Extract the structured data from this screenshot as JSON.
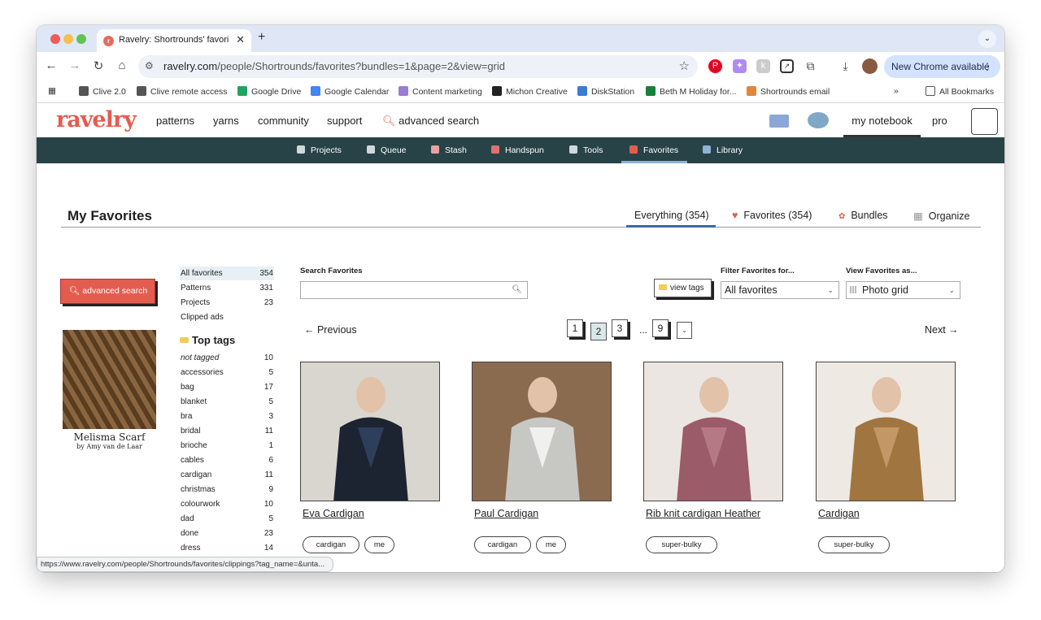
{
  "browser": {
    "tab_title": "Ravelry: Shortrounds' favorite",
    "tab_favicon": "ravelry-favicon",
    "url_domain": "ravelry.com",
    "url_path": "/people/Shortrounds/favorites?bundles=1&page=2&view=grid",
    "update_label": "New Chrome available",
    "status_url": "https://www.ravelry.com/people/Shortrounds/favorites/clippings?tag_name=&unta...",
    "bookmarks": [
      {
        "label": "Clive 2.0",
        "icon": "globe-icon",
        "color": "#555555"
      },
      {
        "label": "Clive remote access",
        "icon": "globe-icon",
        "color": "#555555"
      },
      {
        "label": "Google Drive",
        "icon": "drive-icon",
        "color": "#1fa463"
      },
      {
        "label": "Google Calendar",
        "icon": "calendar-icon",
        "color": "#4285f4"
      },
      {
        "label": "Content marketing",
        "icon": "pinwheel-icon",
        "color": "#9b7bd4"
      },
      {
        "label": "Michon Creative",
        "icon": "m-icon",
        "color": "#222222"
      },
      {
        "label": "DiskStation",
        "icon": "dsm-icon",
        "color": "#3a7bd5"
      },
      {
        "label": "Beth M Holiday for...",
        "icon": "sheets-icon",
        "color": "#188038"
      },
      {
        "label": "Shortrounds email",
        "icon": "link-icon",
        "color": "#e0873a"
      }
    ],
    "all_bookmarks": "All Bookmarks"
  },
  "site": {
    "logo": "ravelry",
    "nav": [
      "patterns",
      "yarns",
      "community",
      "support"
    ],
    "advanced_search": "advanced search",
    "my_notebook": "my notebook",
    "pro": "pro",
    "subnav": [
      {
        "label": "Projects",
        "icon": "projects-icon",
        "color": "#cfd8dc"
      },
      {
        "label": "Queue",
        "icon": "queue-icon",
        "color": "#cfd8dc"
      },
      {
        "label": "Stash",
        "icon": "stash-icon",
        "color": "#e8a0a0"
      },
      {
        "label": "Handspun",
        "icon": "handspun-icon",
        "color": "#e07070"
      },
      {
        "label": "Tools",
        "icon": "tools-icon",
        "color": "#cfd8dc"
      },
      {
        "label": "Favorites",
        "icon": "heart-icon",
        "color": "#e35d4f"
      },
      {
        "label": "Library",
        "icon": "library-icon",
        "color": "#8fb2d6"
      }
    ]
  },
  "page": {
    "title": "My Favorites",
    "tabs": [
      "Everything (354)",
      "Favorites (354)",
      "Bundles",
      "Organize"
    ],
    "adv_search": "advanced search",
    "book_title": "Melisma Scarf",
    "book_author": "by Amy van de Laar",
    "stats": [
      {
        "label": "All favorites",
        "count": "354"
      },
      {
        "label": "Patterns",
        "count": "331"
      },
      {
        "label": "Projects",
        "count": "23"
      },
      {
        "label": "Clipped ads",
        "count": ""
      }
    ],
    "top_tags_title": "Top tags",
    "tags": [
      {
        "label": "not tagged",
        "count": "10"
      },
      {
        "label": "accessories",
        "count": "5"
      },
      {
        "label": "bag",
        "count": "17"
      },
      {
        "label": "blanket",
        "count": "5"
      },
      {
        "label": "bra",
        "count": "3"
      },
      {
        "label": "bridal",
        "count": "11"
      },
      {
        "label": "brioche",
        "count": "1"
      },
      {
        "label": "cables",
        "count": "6"
      },
      {
        "label": "cardigan",
        "count": "11"
      },
      {
        "label": "christmas",
        "count": "9"
      },
      {
        "label": "colourwork",
        "count": "10"
      },
      {
        "label": "dad",
        "count": "5"
      },
      {
        "label": "done",
        "count": "23"
      },
      {
        "label": "dress",
        "count": "14"
      }
    ],
    "search_label": "Search Favorites",
    "search_value": "",
    "view_tags": "view tags",
    "filter_label": "Filter Favorites for...",
    "filter_value": "All favorites",
    "view_label": "View Favorites as...",
    "view_value": "Photo grid",
    "previous": "← Previous",
    "next": "Next →",
    "pages": [
      "1",
      "2",
      "3",
      "...",
      "9"
    ],
    "current_page": "2",
    "cards": [
      {
        "title": "Eva Cardigan",
        "tags": [
          "cardigan",
          "me"
        ],
        "colors": [
          "#d9d6cf",
          "#1c2331",
          "#2e3f5c"
        ]
      },
      {
        "title": "Paul Cardigan",
        "tags": [
          "cardigan",
          "me"
        ],
        "colors": [
          "#8a6b4f",
          "#c7c8c4",
          "#f0f0ee"
        ]
      },
      {
        "title": "Rib knit cardigan Heather",
        "tags": [
          "super-bulky"
        ],
        "colors": [
          "#ebe6e2",
          "#9b5b68",
          "#b57986"
        ]
      },
      {
        "title": "Cardigan",
        "tags": [
          "super-bulky"
        ],
        "colors": [
          "#efe9e4",
          "#a0753f",
          "#c49866"
        ]
      }
    ]
  }
}
